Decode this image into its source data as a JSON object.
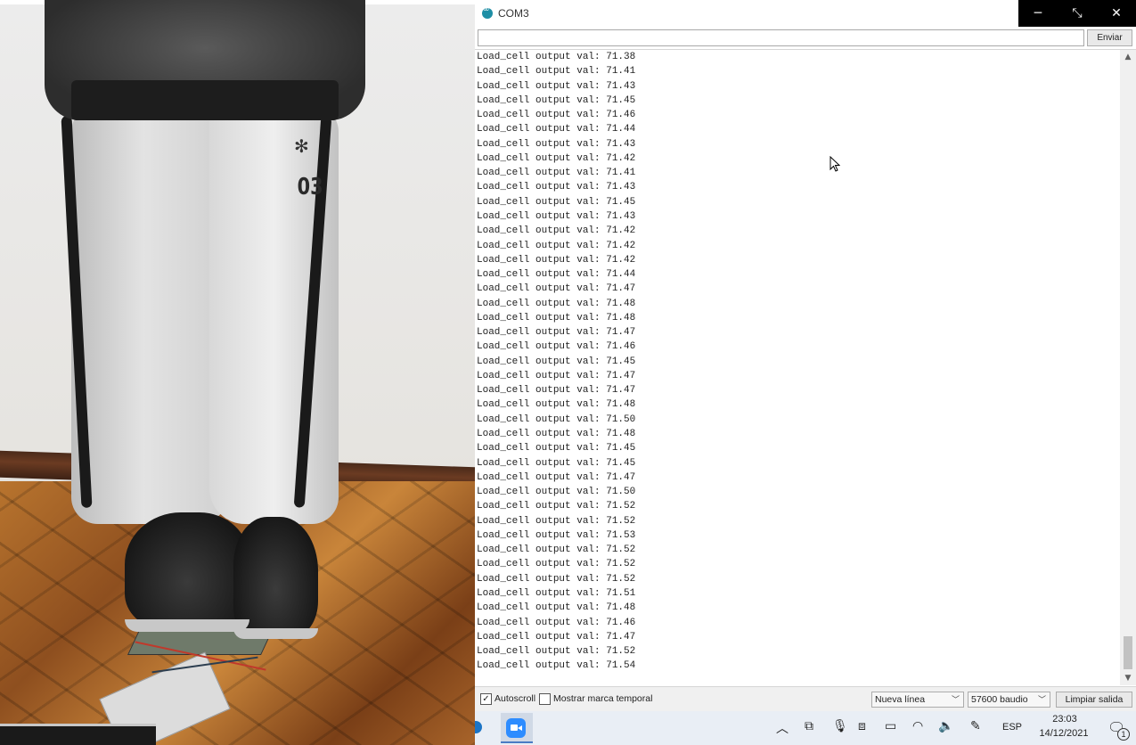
{
  "window": {
    "title": "COM3",
    "controls": {
      "minimize": "─",
      "restore": "⤡",
      "close": "✕"
    }
  },
  "send_bar": {
    "input_value": "",
    "send_label": "Enviar"
  },
  "output_lines": [
    "Load_cell output val: 71.38",
    "Load_cell output val: 71.41",
    "Load_cell output val: 71.43",
    "Load_cell output val: 71.45",
    "Load_cell output val: 71.46",
    "Load_cell output val: 71.44",
    "Load_cell output val: 71.43",
    "Load_cell output val: 71.42",
    "Load_cell output val: 71.41",
    "Load_cell output val: 71.43",
    "Load_cell output val: 71.45",
    "Load_cell output val: 71.43",
    "Load_cell output val: 71.42",
    "Load_cell output val: 71.42",
    "Load_cell output val: 71.42",
    "Load_cell output val: 71.44",
    "Load_cell output val: 71.47",
    "Load_cell output val: 71.48",
    "Load_cell output val: 71.48",
    "Load_cell output val: 71.47",
    "Load_cell output val: 71.46",
    "Load_cell output val: 71.45",
    "Load_cell output val: 71.47",
    "Load_cell output val: 71.47",
    "Load_cell output val: 71.48",
    "Load_cell output val: 71.50",
    "Load_cell output val: 71.48",
    "Load_cell output val: 71.45",
    "Load_cell output val: 71.45",
    "Load_cell output val: 71.47",
    "Load_cell output val: 71.50",
    "Load_cell output val: 71.52",
    "Load_cell output val: 71.52",
    "Load_cell output val: 71.53",
    "Load_cell output val: 71.52",
    "Load_cell output val: 71.52",
    "Load_cell output val: 71.52",
    "Load_cell output val: 71.51",
    "Load_cell output val: 71.48",
    "Load_cell output val: 71.46",
    "Load_cell output val: 71.47",
    "Load_cell output val: 71.52",
    "Load_cell output val: 71.54"
  ],
  "bottom_bar": {
    "autoscroll_label": "Autoscroll",
    "autoscroll_checked": true,
    "timestamp_label": "Mostrar marca temporal",
    "timestamp_checked": false,
    "line_ending": "Nueva línea",
    "baud_rate": "57600 baudio",
    "clear_label": "Limpiar salida"
  },
  "camera_feed": {
    "shirt_number": "03"
  },
  "taskbar": {
    "language": "ESP",
    "time": "23:03",
    "date": "14/12/2021",
    "notification_count": "1"
  },
  "colors": {
    "arduino_teal": "#1e8ea5",
    "zoom_blue": "#2d8cff",
    "titlebar_controls_bg": "#000000"
  }
}
